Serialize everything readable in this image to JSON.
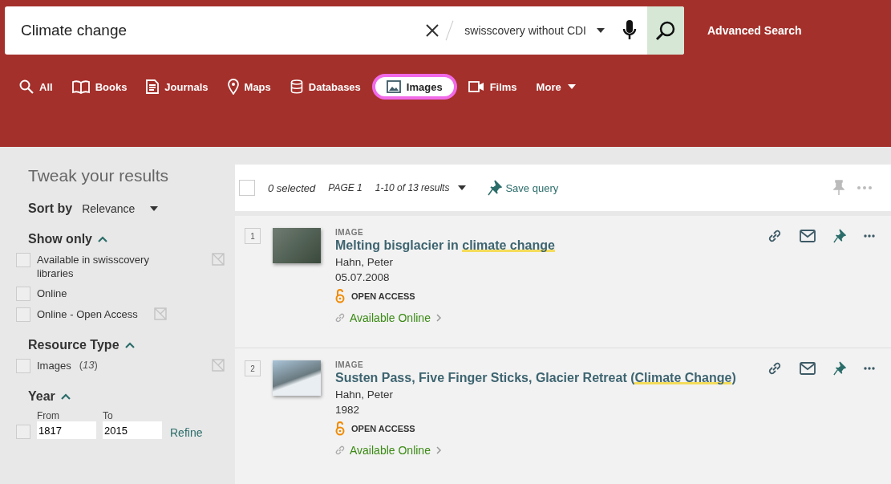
{
  "search": {
    "value": "Climate change",
    "scope": "swisscovery without CDI",
    "advanced": "Advanced Search"
  },
  "tabs": [
    {
      "label": "All",
      "selected": false
    },
    {
      "label": "Books",
      "selected": false
    },
    {
      "label": "Journals",
      "selected": false
    },
    {
      "label": "Maps",
      "selected": false
    },
    {
      "label": "Databases",
      "selected": false
    },
    {
      "label": "Images",
      "selected": true
    },
    {
      "label": "Films",
      "selected": false
    },
    {
      "label": "More",
      "selected": false
    }
  ],
  "sidebar": {
    "title": "Tweak your results",
    "sort_label": "Sort by",
    "sort_value": "Relevance",
    "groups": [
      {
        "title": "Show only",
        "expanded": true,
        "items": [
          {
            "label": "Available in swisscovery libraries",
            "checked": false,
            "excludable": true
          },
          {
            "label": "Online",
            "checked": false,
            "excludable": false
          },
          {
            "label": "Online - Open Access",
            "checked": false,
            "excludable": true
          }
        ]
      },
      {
        "title": "Resource Type",
        "expanded": true,
        "items": [
          {
            "label": "Images",
            "count": "(*13*)",
            "checked": false,
            "excludable": true
          }
        ]
      }
    ],
    "year": {
      "title": "Year",
      "expanded": true,
      "from_label": "From",
      "to_label": "To",
      "from": "1817",
      "to": "2015",
      "refine": "Refine",
      "checked": false
    }
  },
  "toolbar": {
    "selected_count": "0 selected",
    "page": "PAGE 1",
    "range": "1-10 of 13 results",
    "save": "Save query",
    "all_checked": false
  },
  "results": [
    {
      "number": "1",
      "type": "IMAGE",
      "title_before": "Melting bisglacier in ",
      "title_highlight": "climate change",
      "author": "Hahn, Peter",
      "date": "05.07.2008",
      "access": "OPEN ACCESS",
      "availability": "Available Online"
    },
    {
      "number": "2",
      "type": "IMAGE",
      "title_before": "Susten Pass, Five Finger Sticks, Glacier Retreat (",
      "title_highlight": "Climate Change",
      "title_after": ")",
      "author": "Hahn, Peter",
      "date": "1982",
      "access": "OPEN ACCESS",
      "availability": "Available Online"
    }
  ]
}
